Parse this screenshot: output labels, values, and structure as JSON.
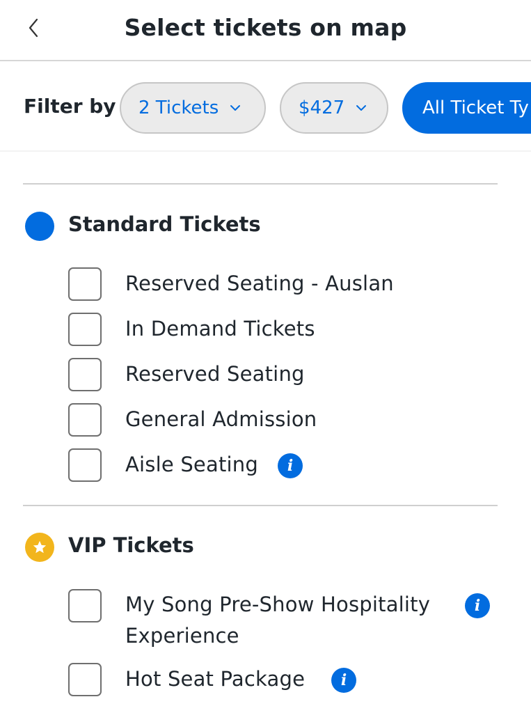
{
  "header": {
    "title": "Select tickets on map",
    "back_icon": "chevron-left-icon"
  },
  "filters": {
    "label": "Filter by",
    "quantity": "2 Tickets",
    "price": "$427",
    "type": "All Ticket Ty",
    "colors": {
      "accent": "#026cdf",
      "pill_bg": "#ebebeb"
    }
  },
  "sections": [
    {
      "title": "Standard Tickets",
      "marker_color": "#026cdf",
      "options": [
        {
          "label": "Reserved Seating - Auslan",
          "checked": false
        },
        {
          "label": "In Demand Tickets",
          "checked": false
        },
        {
          "label": "Reserved Seating",
          "checked": false
        },
        {
          "label": "General Admission",
          "checked": false
        },
        {
          "label": "Aisle Seating",
          "checked": false,
          "info": true
        }
      ]
    },
    {
      "title": "VIP Tickets",
      "marker_color": "#f2b51c",
      "marker_icon": "star-icon",
      "options": [
        {
          "label_line1": "My Song Pre-Show Hospitality",
          "label_line2": "Experience",
          "checked": false,
          "info": true
        },
        {
          "label": "Hot Seat Package",
          "checked": false,
          "info": true
        }
      ]
    }
  ],
  "info_glyph": "i"
}
